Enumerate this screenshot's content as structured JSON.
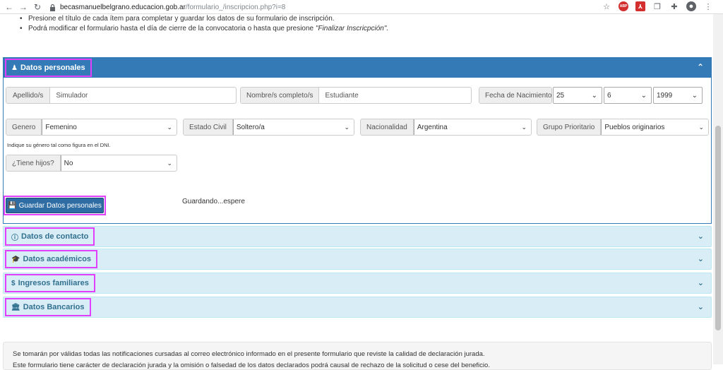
{
  "browser": {
    "host": "becasmanuelbelgrano.educacion.gob.ar",
    "path": "/formulario_/inscripcion.php?i=8",
    "abp": "ABP"
  },
  "instructions": [
    "Presione el título de cada ítem para completar y guardar los datos de su formulario de inscripción.",
    "Podrá modificar el formulario hasta el día de cierre de la convocatoria o hasta que presione "
  ],
  "instructions_em": "\"Finalizar Inscricpción\".",
  "personal": {
    "title": "Datos personales",
    "apellido_label": "Apellido/s",
    "apellido_value": "Simulador",
    "nombre_label": "Nombre/s completo/s",
    "nombre_value": "Estudiante",
    "fecha_label": "Fecha de Nacimiento",
    "dia": "25",
    "mes": "6",
    "anio": "1999",
    "genero_label": "Genero",
    "genero_value": "Femenino",
    "estado_label": "Estado Civil",
    "estado_value": "Soltero/a",
    "nacionalidad_label": "Nacionalidad",
    "nacionalidad_value": "Argentina",
    "grupo_label": "Grupo Prioritario",
    "grupo_value": "Pueblos originarios",
    "hint": "Indique su género tal como figura en el DNI.",
    "hijos_label": "¿Tiene hijos?",
    "hijos_value": "No",
    "save_label": "Guardar Datos personales",
    "saving_text": "Guardando...espere"
  },
  "sections": {
    "contacto": "Datos de contacto",
    "academicos": "Datos académicos",
    "ingresos": "Ingresos familiares",
    "bancarios": "Datos Bancarios"
  },
  "footer": {
    "line1": "Se tomarán por válidas todas las notificaciones cursadas al correo electrónico informado en el presente formulario que reviste la calidad de declaración jurada.",
    "line2": "Este formulario tiene carácter de declaración jurada y la omisión o falsedad de los datos declarados podrá causal de rechazo de la solicitud o cese del beneficio."
  },
  "colors": {
    "primary": "#337ab7",
    "highlight": "#e040fb",
    "collapsed_panel": "#d9edf7"
  }
}
